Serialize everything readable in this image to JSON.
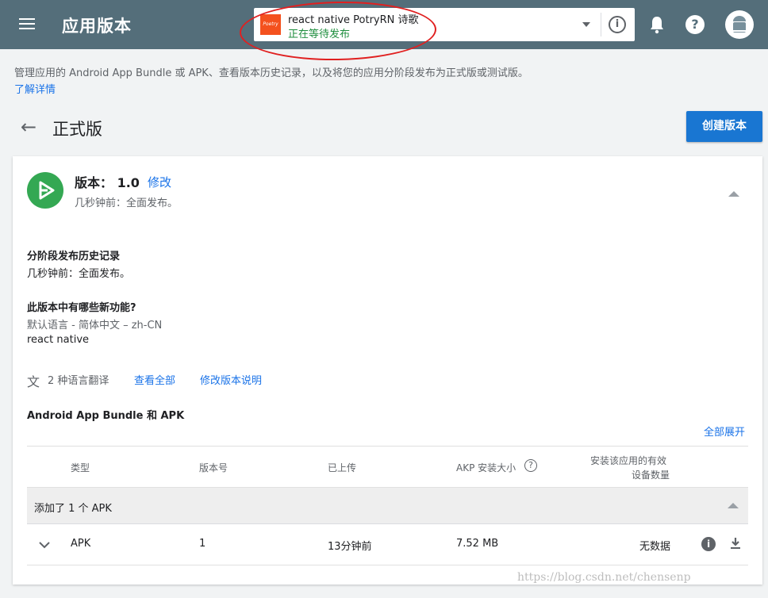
{
  "topbar": {
    "title": "应用版本",
    "app": {
      "logo_text": "Poetry",
      "name": "react native PotryRN 诗歌",
      "status": "正在等待发布",
      "status_color": "#1e8e3e"
    },
    "info_glyph": "i",
    "help_glyph": "?"
  },
  "description": "管理应用的 Android App Bundle 或 APK、查看版本历史记录，以及将您的应用分阶段发布为正式版或测试版。",
  "learn_more": "了解详情",
  "page": {
    "title": "正式版",
    "create_button": "创建版本"
  },
  "release": {
    "version_label": "版本：",
    "version_value": "1.0",
    "edit": "修改",
    "subtitle": "几秒钟前：全面发布。",
    "rollout_heading": "分阶段发布历史记录",
    "rollout_text": "几秒钟前：全面发布。",
    "whats_new_heading": "此版本中有哪些新功能?",
    "default_lang": "默认语言 - 简体中文 – zh-CN",
    "notes": "react native",
    "translations": "2 种语言翻译",
    "view_all": "查看全部",
    "edit_notes": "修改版本说明"
  },
  "bundles": {
    "heading": "Android App Bundle 和 APK",
    "expand_all": "全部展开",
    "columns": {
      "type": "类型",
      "version_code": "版本号",
      "uploaded": "已上传",
      "size": "AKP 安装大小",
      "devices_line1": "安装该应用的有效",
      "devices_line2": "设备数量"
    },
    "group_label": "添加了 1 个 APK",
    "rows": [
      {
        "type": "APK",
        "version": "1",
        "uploaded": "13分钟前",
        "size": "7.52 MB",
        "devices": "无数据"
      }
    ]
  },
  "watermark": "https://blog.csdn.net/chensenp",
  "colors": {
    "topbar": "#546e7a",
    "accent": "#1976d2",
    "release_icon": "#34a853"
  }
}
